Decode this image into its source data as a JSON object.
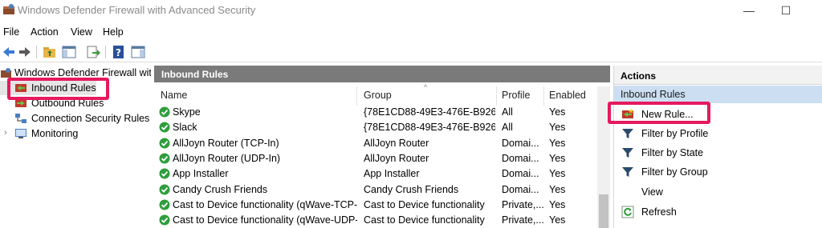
{
  "window": {
    "title": "Windows Defender Firewall with Advanced Security",
    "minimize_glyph": "—",
    "maximize_glyph": "☐"
  },
  "menu": [
    "File",
    "Action",
    "View",
    "Help"
  ],
  "toolbar_icons": [
    "back-arrow-icon",
    "forward-arrow-icon",
    "up-folder-icon",
    "show-hide-tree-icon",
    "export-list-icon",
    "help-icon",
    "show-hide-action-pane-icon"
  ],
  "tree": {
    "root": "Windows Defender Firewall with Advanced Security",
    "items": [
      {
        "label": "Inbound Rules",
        "icon": "inbound-rules-icon",
        "selected": true
      },
      {
        "label": "Outbound Rules",
        "icon": "outbound-rules-icon"
      },
      {
        "label": "Connection Security Rules",
        "icon": "connection-security-icon"
      },
      {
        "label": "Monitoring",
        "icon": "monitoring-icon",
        "expander": "›"
      }
    ]
  },
  "middle": {
    "header": "Inbound Rules",
    "columns": {
      "name": "Name",
      "group": "Group",
      "profile": "Profile",
      "enabled": "Enabled"
    },
    "sort_indicator": "^",
    "rows": [
      {
        "name": "Skype",
        "group": "{78E1CD88-49E3-476E-B926-...",
        "profile": "All",
        "enabled": "Yes"
      },
      {
        "name": "Slack",
        "group": "{78E1CD88-49E3-476E-B926-...",
        "profile": "All",
        "enabled": "Yes"
      },
      {
        "name": "AllJoyn Router (TCP-In)",
        "group": "AllJoyn Router",
        "profile": "Domai...",
        "enabled": "Yes"
      },
      {
        "name": "AllJoyn Router (UDP-In)",
        "group": "AllJoyn Router",
        "profile": "Domai...",
        "enabled": "Yes"
      },
      {
        "name": "App Installer",
        "group": "App Installer",
        "profile": "Domai...",
        "enabled": "Yes"
      },
      {
        "name": "Candy Crush Friends",
        "group": "Candy Crush Friends",
        "profile": "Domai...",
        "enabled": "Yes"
      },
      {
        "name": "Cast to Device functionality (qWave-TCP-In)",
        "group": "Cast to Device functionality",
        "profile": "Private,...",
        "enabled": "Yes"
      },
      {
        "name": "Cast to Device functionality (qWave-UDP-...",
        "group": "Cast to Device functionality",
        "profile": "Private,...",
        "enabled": "Yes"
      }
    ]
  },
  "actions": {
    "header": "Actions",
    "section": "Inbound Rules",
    "items": [
      {
        "label": "New Rule...",
        "icon": "new-rule-icon"
      },
      {
        "label": "Filter by Profile",
        "icon": "filter-icon"
      },
      {
        "label": "Filter by State",
        "icon": "filter-icon"
      },
      {
        "label": "Filter by Group",
        "icon": "filter-icon"
      },
      {
        "label": "View",
        "icon": ""
      },
      {
        "label": "Refresh",
        "icon": "refresh-icon"
      }
    ]
  },
  "colors": {
    "highlight": "#e6195f",
    "pane_header": "#7a7a7a",
    "action_section": "#ccdff2",
    "check_green": "#2e9e3c"
  }
}
